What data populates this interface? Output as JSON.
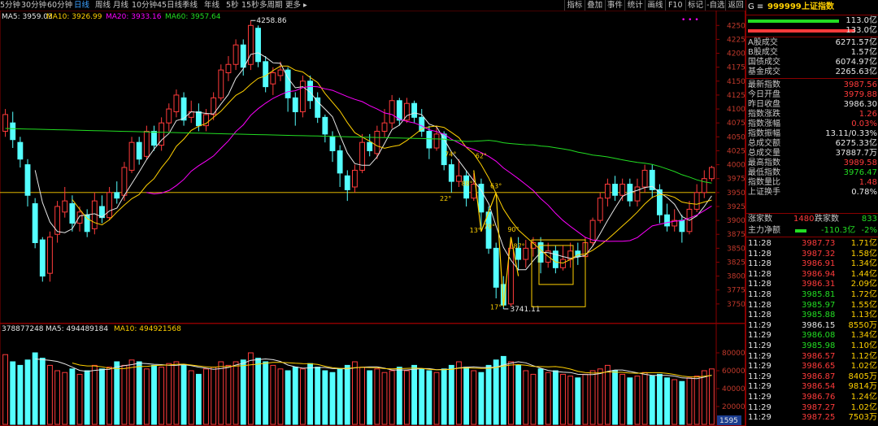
{
  "periods": [
    "5分钟",
    "30分钟",
    "60分钟",
    "日线",
    "周线",
    "月线",
    "10分钟",
    "45日线",
    "季线",
    "年线",
    "5秒",
    "15秒",
    "多周期",
    "更多 ▸"
  ],
  "active_period": 3,
  "tools": [
    "指标",
    "叠加",
    "事件",
    "统计",
    "画线",
    "F10",
    "标记",
    "-自选",
    "返回"
  ],
  "ma_legend": [
    {
      "label": "MA5: 3959.03",
      "color": "#e6e6e6"
    },
    {
      "label": "MA10: 3926.99",
      "color": "#ffd000"
    },
    {
      "label": "MA20: 3933.16",
      "color": "#ff00ff"
    },
    {
      "label": "MA60: 3957.64",
      "color": "#22dd22"
    }
  ],
  "vol_legend": [
    {
      "label": "378877248",
      "color": "#e6e6e6"
    },
    {
      "label": "MA5: 494489184",
      "color": "#e6e6e6"
    },
    {
      "label": "MA10: 494921568",
      "color": "#ffd000"
    }
  ],
  "colors": {
    "up": "#ff3b3b",
    "down": "#54ffff",
    "ma5": "#e6e6e6",
    "ma10": "#ffd000",
    "ma20": "#ff00ff",
    "ma60": "#22dd22",
    "border": "#8a0000"
  },
  "annotations": {
    "high": "4258.86",
    "low": "3741.11",
    "dots": "• • •"
  },
  "chart_marks": [
    "74°",
    "62°",
    "88°",
    "63°",
    "22°",
    "13°",
    "79°",
    "90°",
    "87°",
    "17°"
  ],
  "price_axis": [
    4250,
    4225,
    4200,
    4175,
    4150,
    4125,
    4100,
    4075,
    4050,
    4025,
    4000,
    3975,
    3950,
    3925,
    3900,
    3875,
    3850,
    3825,
    3800,
    3775,
    3750
  ],
  "vol_axis": [
    "80000",
    "60000",
    "40000",
    "20000"
  ],
  "vol_corner": "1595",
  "chart_data": {
    "type": "candlestick",
    "ylim": [
      3725,
      4265
    ],
    "reference_line": 3950,
    "volume_ylim": [
      0,
      100000
    ],
    "candles": [
      [
        4060,
        4090,
        4100,
        4050
      ],
      [
        4075,
        4045,
        4095,
        4030
      ],
      [
        4040,
        4010,
        4050,
        3995
      ],
      [
        4000,
        3945,
        4010,
        3925
      ],
      [
        3930,
        3860,
        3940,
        3850
      ],
      [
        3865,
        3800,
        3870,
        3790
      ],
      [
        3805,
        3870,
        3880,
        3790
      ],
      [
        3875,
        3925,
        3935,
        3860
      ],
      [
        3915,
        3935,
        3960,
        3905
      ],
      [
        3930,
        3895,
        3945,
        3880
      ],
      [
        3895,
        3915,
        3925,
        3880
      ],
      [
        3910,
        3880,
        3920,
        3870
      ],
      [
        3885,
        3935,
        3950,
        3875
      ],
      [
        3925,
        3905,
        3945,
        3895
      ],
      [
        3905,
        3950,
        3960,
        3900
      ],
      [
        3950,
        3940,
        3970,
        3930
      ],
      [
        3945,
        3995,
        4005,
        3935
      ],
      [
        3990,
        4040,
        4050,
        3985
      ],
      [
        4040,
        4010,
        4050,
        4000
      ],
      [
        4015,
        4060,
        4070,
        4010
      ],
      [
        4060,
        4035,
        4070,
        4025
      ],
      [
        4035,
        4075,
        4085,
        4025
      ],
      [
        4075,
        4100,
        4110,
        4060
      ],
      [
        4095,
        4125,
        4135,
        4085
      ],
      [
        4120,
        4080,
        4130,
        4070
      ],
      [
        4085,
        4095,
        4115,
        4075
      ],
      [
        4095,
        4070,
        4110,
        4060
      ],
      [
        4070,
        4090,
        4100,
        4060
      ],
      [
        4090,
        4120,
        4130,
        4080
      ],
      [
        4120,
        4170,
        4180,
        4115
      ],
      [
        4165,
        4180,
        4195,
        4150
      ],
      [
        4180,
        4215,
        4225,
        4170
      ],
      [
        4215,
        4175,
        4225,
        4160
      ],
      [
        4180,
        4250,
        4258.86,
        4170
      ],
      [
        4245,
        4185,
        4250,
        4175
      ],
      [
        4185,
        4140,
        4195,
        4130
      ],
      [
        4145,
        4165,
        4175,
        4125
      ],
      [
        4160,
        4170,
        4185,
        4150
      ],
      [
        4170,
        4120,
        4175,
        4095
      ],
      [
        4120,
        4095,
        4130,
        4070
      ],
      [
        4095,
        4150,
        4160,
        4085
      ],
      [
        4150,
        4115,
        4160,
        4100
      ],
      [
        4120,
        4085,
        4130,
        4075
      ],
      [
        4085,
        4055,
        4090,
        4040
      ],
      [
        4050,
        4025,
        4060,
        4005
      ],
      [
        4025,
        3985,
        4035,
        3960
      ],
      [
        3980,
        3955,
        3990,
        3935
      ],
      [
        3960,
        3990,
        4000,
        3950
      ],
      [
        3990,
        4040,
        4055,
        3985
      ],
      [
        4040,
        4025,
        4055,
        4015
      ],
      [
        4020,
        4060,
        4070,
        4010
      ],
      [
        4060,
        4075,
        4100,
        4050
      ],
      [
        4075,
        4115,
        4125,
        4065
      ],
      [
        4115,
        4080,
        4120,
        4070
      ],
      [
        4080,
        4110,
        4120,
        4075
      ],
      [
        4110,
        4085,
        4115,
        4075
      ],
      [
        4085,
        4060,
        4100,
        4050
      ],
      [
        4060,
        4030,
        4070,
        4010
      ],
      [
        4030,
        4055,
        4070,
        4025
      ],
      [
        4055,
        4000,
        4060,
        3990
      ],
      [
        4000,
        3970,
        4010,
        3950
      ],
      [
        3970,
        3980,
        4010,
        3960
      ],
      [
        3980,
        3940,
        3990,
        3925
      ],
      [
        3940,
        3965,
        3985,
        3935
      ],
      [
        3965,
        3915,
        3975,
        3880
      ],
      [
        3915,
        3850,
        3925,
        3840
      ],
      [
        3850,
        3780,
        3860,
        3760
      ],
      [
        3785,
        3748,
        3800,
        3741.11
      ],
      [
        3750,
        3850,
        3870,
        3745
      ],
      [
        3850,
        3830,
        3870,
        3810
      ],
      [
        3830,
        3850,
        3865,
        3815
      ],
      [
        3850,
        3860,
        3870,
        3835
      ],
      [
        3860,
        3825,
        3870,
        3805
      ],
      [
        3825,
        3845,
        3860,
        3815
      ],
      [
        3845,
        3815,
        3855,
        3805
      ],
      [
        3815,
        3830,
        3855,
        3810
      ],
      [
        3830,
        3845,
        3860,
        3815
      ],
      [
        3845,
        3835,
        3860,
        3820
      ],
      [
        3835,
        3860,
        3870,
        3825
      ],
      [
        3860,
        3900,
        3905,
        3855
      ],
      [
        3900,
        3940,
        3950,
        3895
      ],
      [
        3940,
        3965,
        3975,
        3925
      ],
      [
        3965,
        3945,
        3980,
        3935
      ],
      [
        3945,
        3965,
        3975,
        3935
      ],
      [
        3965,
        3935,
        3975,
        3925
      ],
      [
        3935,
        3960,
        3975,
        3925
      ],
      [
        3960,
        3990,
        4000,
        3950
      ],
      [
        3990,
        3955,
        4000,
        3940
      ],
      [
        3955,
        3910,
        3965,
        3895
      ],
      [
        3910,
        3890,
        3930,
        3880
      ],
      [
        3890,
        3900,
        3920,
        3880
      ],
      [
        3900,
        3880,
        3910,
        3860
      ],
      [
        3880,
        3920,
        3935,
        3875
      ],
      [
        3920,
        3950,
        3965,
        3915
      ],
      [
        3950,
        3975,
        3990,
        3940
      ],
      [
        3975,
        3995,
        3998,
        3970
      ]
    ],
    "volumes": [
      78,
      70,
      66,
      72,
      80,
      74,
      66,
      60,
      58,
      62,
      56,
      60,
      66,
      62,
      64,
      70,
      66,
      72,
      70,
      62,
      66,
      64,
      68,
      70,
      66,
      60,
      56,
      62,
      64,
      70,
      66,
      70,
      72,
      80,
      74,
      70,
      66,
      62,
      60,
      64,
      62,
      68,
      64,
      60,
      58,
      62,
      66,
      70,
      64,
      60,
      62,
      58,
      60,
      64,
      60,
      66,
      62,
      60,
      58,
      62,
      66,
      70,
      64,
      60,
      58,
      66,
      72,
      76,
      70,
      66,
      60,
      56,
      62,
      58,
      60,
      56,
      54,
      52,
      56,
      60,
      62,
      66,
      60,
      56,
      52,
      54,
      58,
      54,
      56,
      52,
      50,
      48,
      52,
      54,
      60,
      62
    ]
  },
  "panel": {
    "code_prefix": "G ≡",
    "code": "999999",
    "name": "上证指数",
    "bar_labels": [
      "113.0亿",
      "133.0亿"
    ],
    "sections": [
      [
        {
          "label": "A股成交",
          "value": "6271.57亿",
          "color": "white"
        },
        {
          "label": "B股成交",
          "value": "1.57亿",
          "color": "white"
        },
        {
          "label": "国债成交",
          "value": "6074.97亿",
          "color": "white"
        },
        {
          "label": "基金成交",
          "value": "2265.63亿",
          "color": "white"
        }
      ],
      [
        {
          "label": "最新指数",
          "value": "3987.56",
          "color": "red"
        },
        {
          "label": "今日开盘",
          "value": "3979.88",
          "color": "red"
        },
        {
          "label": "昨日收盘",
          "value": "3986.30",
          "color": "white"
        },
        {
          "label": "指数涨跌",
          "value": "1.26",
          "color": "red"
        },
        {
          "label": "指数涨幅",
          "value": "0.03%",
          "color": "red"
        },
        {
          "label": "指数振幅",
          "value": "13.11/0.33%",
          "color": "white"
        },
        {
          "label": "总成交额",
          "value": "6275.33亿",
          "color": "white"
        },
        {
          "label": "总成交量",
          "value": "37887.7万",
          "color": "white"
        },
        {
          "label": "最高指数",
          "value": "3989.58",
          "color": "red"
        },
        {
          "label": "最低指数",
          "value": "3976.47",
          "color": "green"
        },
        {
          "label": "指数量比",
          "value": "1.48",
          "color": "red"
        },
        {
          "label": "上证换手",
          "value": "0.78%",
          "color": "white"
        }
      ]
    ],
    "rise_label": "涨家数",
    "rise_value": "1480",
    "fall_label": "跌家数",
    "fall_value": "833",
    "flow_label": "主力净额",
    "flow_value": "-110.3亿",
    "flow_pct": "-2%",
    "ticks": [
      [
        "11:28",
        "3987.73",
        "1.71亿",
        "red"
      ],
      [
        "11:28",
        "3987.32",
        "1.58亿",
        "red"
      ],
      [
        "11:28",
        "3986.91",
        "1.34亿",
        "red"
      ],
      [
        "11:28",
        "3986.94",
        "1.44亿",
        "red"
      ],
      [
        "11:28",
        "3986.31",
        "2.09亿",
        "red"
      ],
      [
        "11:28",
        "3985.81",
        "1.72亿",
        "green"
      ],
      [
        "11:28",
        "3985.97",
        "1.55亿",
        "green"
      ],
      [
        "11:28",
        "3985.88",
        "1.13亿",
        "green"
      ],
      [
        "11:29",
        "3986.15",
        "8550万",
        "white"
      ],
      [
        "11:29",
        "3986.08",
        "1.34亿",
        "green"
      ],
      [
        "11:29",
        "3985.98",
        "1.10亿",
        "green"
      ],
      [
        "11:29",
        "3986.57",
        "1.12亿",
        "red"
      ],
      [
        "11:29",
        "3986.65",
        "1.02亿",
        "red"
      ],
      [
        "11:29",
        "3986.87",
        "8405万",
        "red"
      ],
      [
        "11:29",
        "3986.54",
        "9814万",
        "red"
      ],
      [
        "11:29",
        "3986.76",
        "1.24亿",
        "red"
      ],
      [
        "11:29",
        "3987.27",
        "1.02亿",
        "red"
      ],
      [
        "11:29",
        "3987.25",
        "7503万",
        "red"
      ]
    ]
  }
}
